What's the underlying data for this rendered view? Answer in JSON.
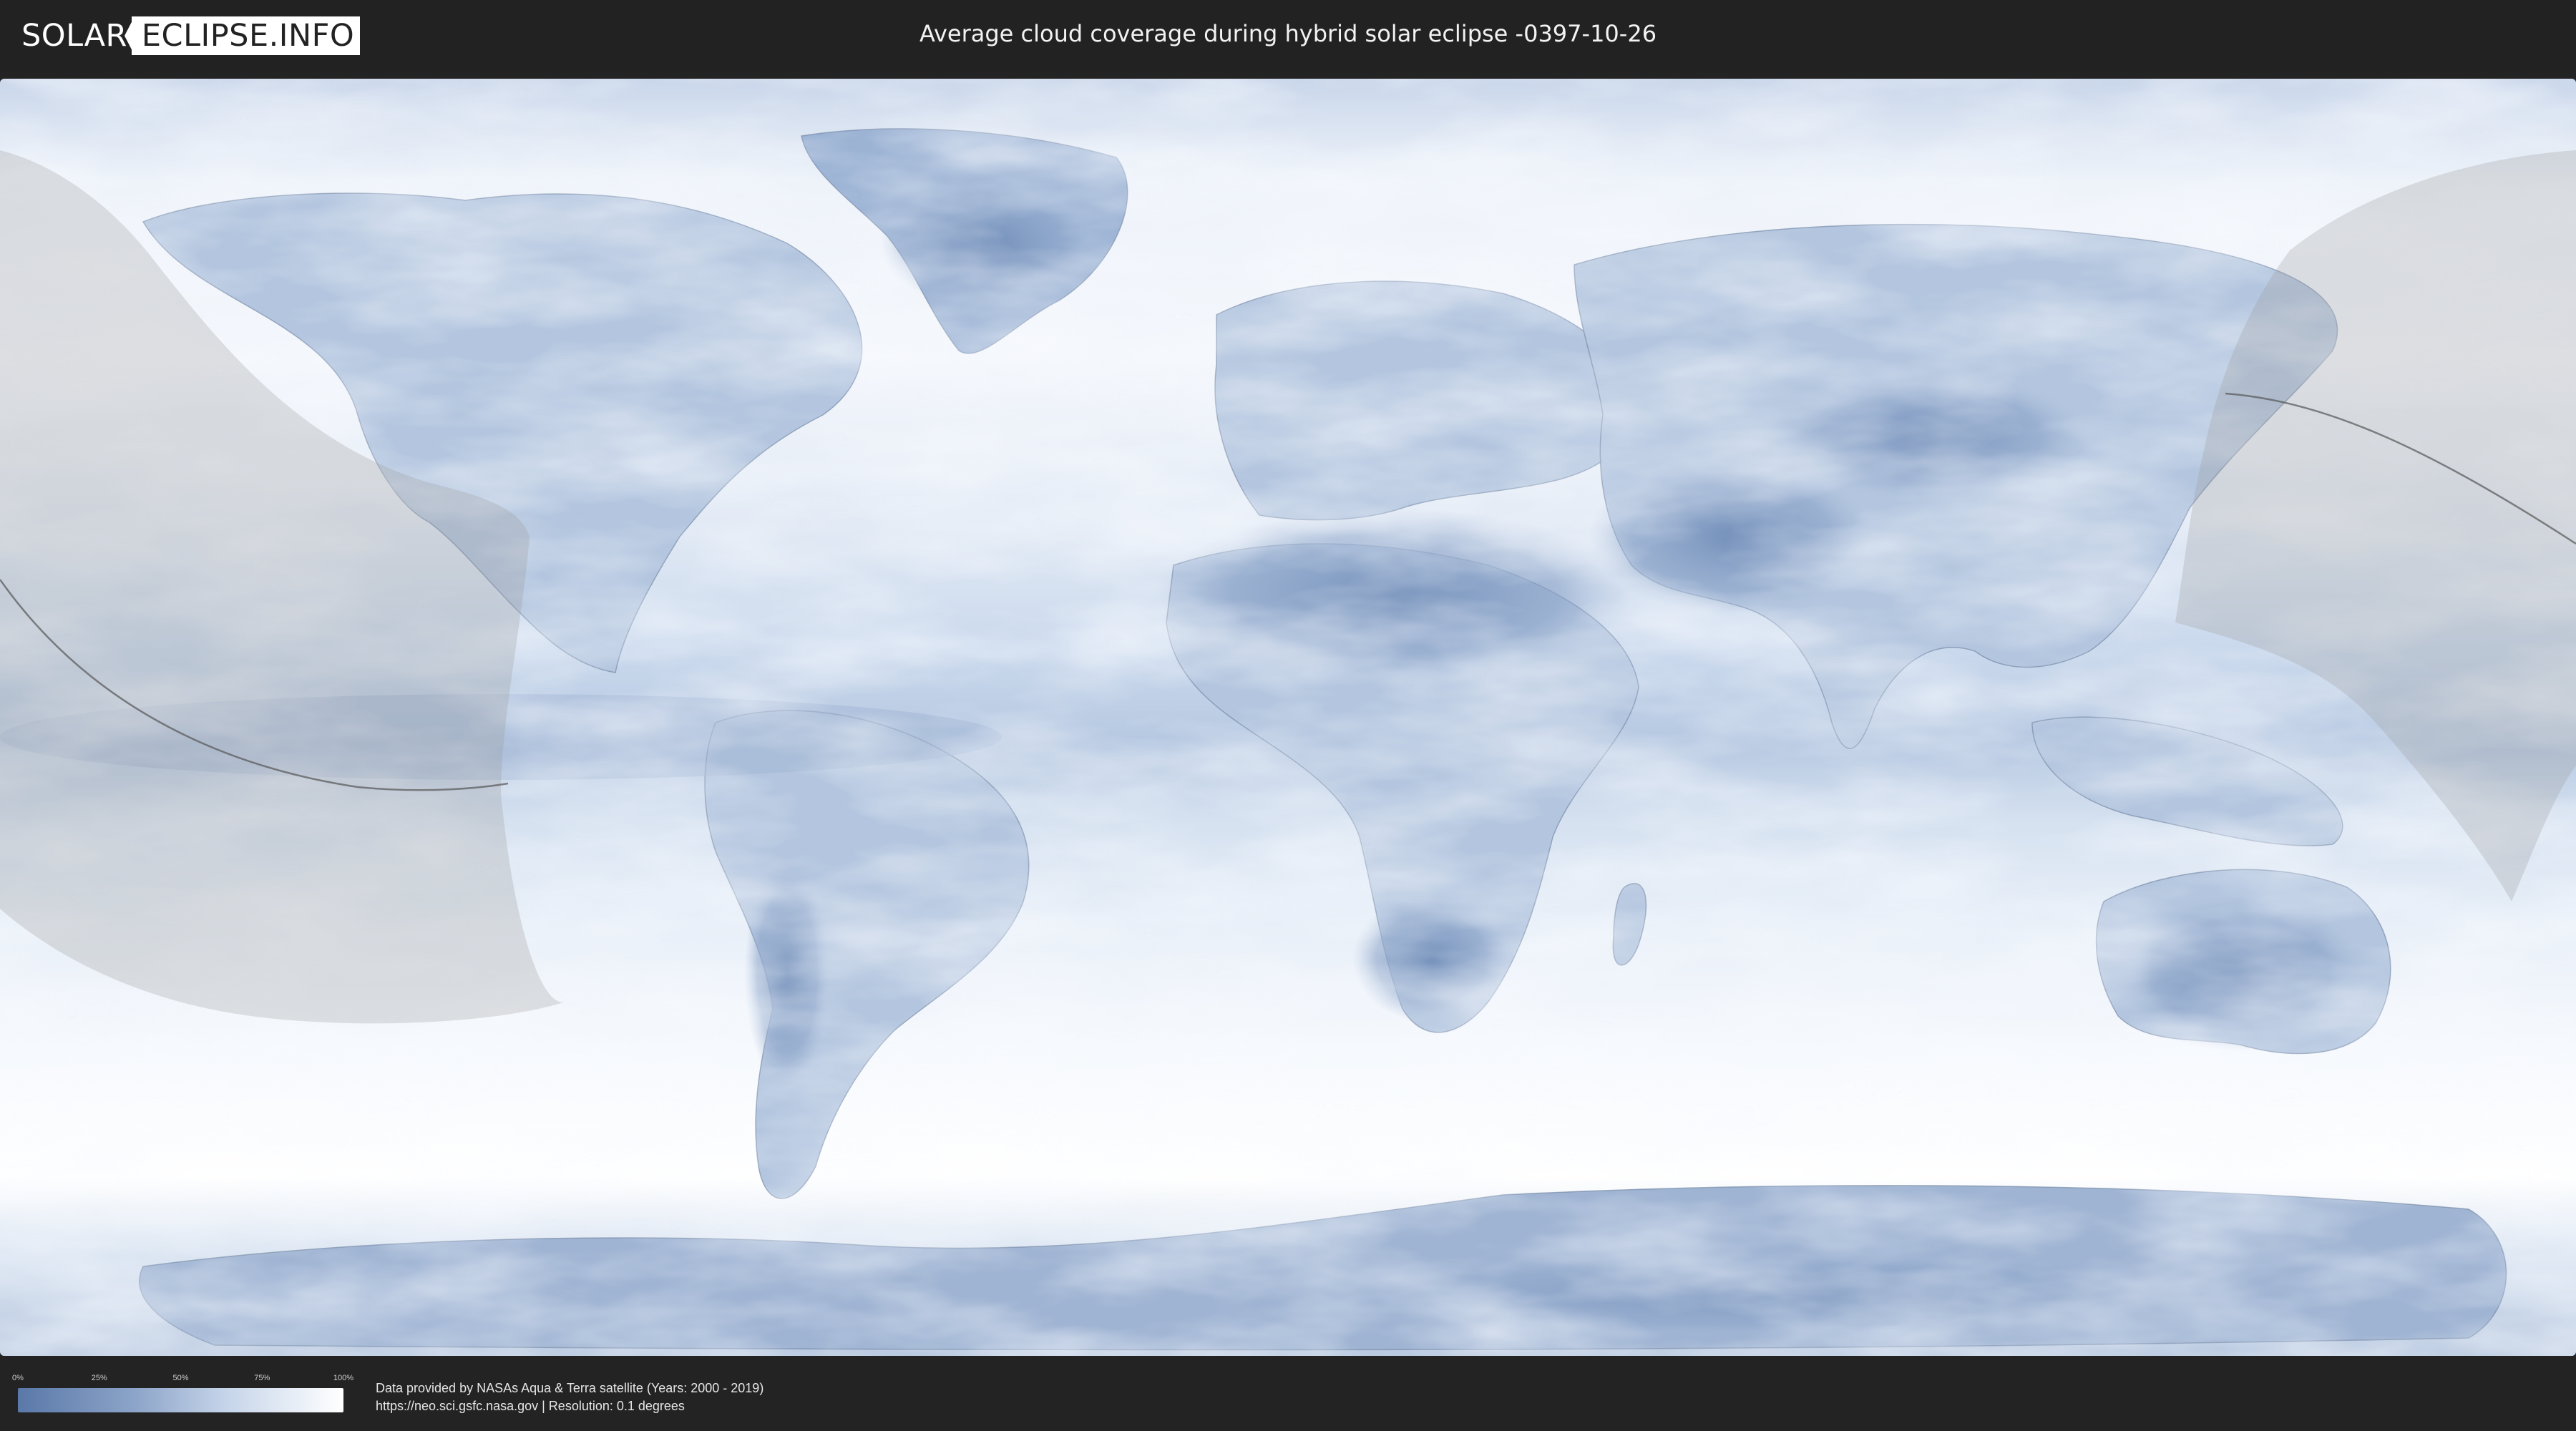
{
  "header": {
    "logo_left": "SOLAR",
    "logo_right": "ECLIPSE.INFO",
    "title": "Average cloud coverage during hybrid solar eclipse -0397-10-26"
  },
  "legend": {
    "ticks": [
      "0%",
      "25%",
      "50%",
      "75%",
      "100%"
    ],
    "tick_fractions": [
      0,
      0.25,
      0.5,
      0.75,
      1
    ],
    "gradient_colors": [
      "#5a78a8",
      "#8ba3c8",
      "#c8d6ea",
      "#ffffff"
    ]
  },
  "credits": {
    "line1": "Data provided by NASAs Aqua & Terra satellite (Years: 2000 - 2019)",
    "line2": "https://neo.sci.gsfc.nasa.gov | Resolution: 0.1 degrees"
  },
  "map": {
    "projection": "equirectangular",
    "colors": {
      "background": "#e6eef8",
      "cloud_low": "#5f7fae",
      "cloud_high": "#ffffff",
      "land_outline": "#6a7f9c",
      "eclipse_overlay": "#a8a8a8",
      "path_line": "#555555"
    }
  }
}
